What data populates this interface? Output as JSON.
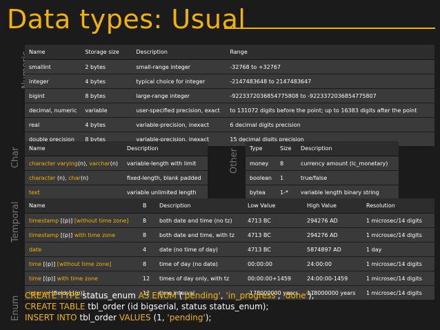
{
  "title": "Data types: Usual",
  "sections": {
    "numeric": "Numeric",
    "char": "Char",
    "other": "Other",
    "temporal": "Temporal",
    "enum": "Enum"
  },
  "numeric_table": {
    "headers": [
      "Name",
      "Storage size",
      "Description",
      "Range"
    ],
    "rows": [
      [
        "smallint",
        "2 bytes",
        "small-range integer",
        "-32768 to +32767"
      ],
      [
        "integer",
        "4 bytes",
        "typical choice for integer",
        "-2147483648 to 2147483647"
      ],
      [
        "bigint",
        "8 bytes",
        "large-range integer",
        "-9223372036854775808 to -9223372036854775807"
      ],
      [
        "decimal, numeric",
        "variable",
        "user-specified precision, exact",
        "to 131072 digits before the point; up to 16383 digits after the point"
      ],
      [
        "real",
        "4 bytes",
        "variable-precision, inexact",
        "6 decimal digits precision"
      ],
      [
        "double precision",
        "8 bytes",
        "variable-precision, inexact",
        "15 decimal digits precision"
      ]
    ]
  },
  "char_table": {
    "headers": [
      "Name",
      "Description"
    ],
    "rows": [
      {
        "n1": "character varying",
        "p1": "(n), ",
        "n2": "varchar",
        "p2": "(n)",
        "desc": "variable-length with limit"
      },
      {
        "n1": "character",
        "p1": " (n), ",
        "n2": "char",
        "p2": "(n)",
        "desc": "fixed-length, blank padded"
      },
      {
        "n1": "text",
        "p1": "",
        "n2": "",
        "p2": "",
        "desc": "variable unlimited length"
      }
    ]
  },
  "other_table": {
    "headers": [
      "Type",
      "Size",
      "Description"
    ],
    "rows": [
      [
        "money",
        "8",
        "currency amount (lc_monetary)"
      ],
      [
        "boolean",
        "1",
        "true/false"
      ],
      [
        "bytea",
        "1-*",
        "variable length binary string"
      ]
    ]
  },
  "temporal_table": {
    "headers": [
      "Name",
      "B",
      "Description",
      "Low Value",
      "High Value",
      "Resolution"
    ],
    "rows": [
      {
        "k1": "timestamp",
        "m": " [(p)] ",
        "k2": "[without time zone]",
        "b": "8",
        "desc": "both date and time (no tz)",
        "low": "4713 BC",
        "high": "294276 AD",
        "res": "1 microsec/14 digits"
      },
      {
        "k1": "timestamp",
        "m": " [(p)] ",
        "k2": "with time zone",
        "b": "8",
        "desc": "both date and time, with tz",
        "low": "4713 BC",
        "high": "294276 AD",
        "res": "1 microsec/14 digits"
      },
      {
        "k1": "date",
        "m": "",
        "k2": "",
        "b": "4",
        "desc": "date (no time of day)",
        "low": "4713 BC",
        "high": "5874897 AD",
        "res": "1 day"
      },
      {
        "k1": "time",
        "m": " [(p)] ",
        "k2": "[without time zone]",
        "b": "8",
        "desc": "time of day (no date)",
        "low": "00:00:00",
        "high": "24:00:00",
        "res": "1 microsec/14 digits"
      },
      {
        "k1": "time",
        "m": " [(p)] ",
        "k2": "with time zone",
        "b": "12",
        "desc": "times of day only, with tz",
        "low": "00:00:00+1459",
        "high": "24:00:00-1459",
        "res": "1 microsec/14 digits"
      },
      {
        "k1": "interval",
        "m": " [fields] [(p)]",
        "k2": "",
        "b": "12",
        "desc": "time interval",
        "low": "-178000000 years",
        "high": "178000000 years",
        "res": "1 microsec/14 digits"
      }
    ]
  },
  "enum_code": {
    "line1": {
      "kw1": "CREATE TYPE",
      "t1": " status_enum ",
      "kw2": "AS ENUM",
      "t2": " (",
      "s1": "'pending'",
      "t3": ", ",
      "s2": "'in_progress'",
      "t4": ", ",
      "s3": "'done'",
      "t5": ");"
    },
    "line2": {
      "kw1": "CREATE TABLE",
      "t1": " tbl_order (id bigserial, status status_enum);"
    },
    "line3": {
      "kw1": "INSERT INTO",
      "t1": " tbl_order ",
      "kw2": "VALUES",
      "t2": " (1, ",
      "s1": "'pending'",
      "t3": ");"
    }
  },
  "colors": {
    "accent": "#f3b400",
    "background": "#1b1b1b",
    "header_bg": "#2d2d2d",
    "row_bg": "#3a3a3a",
    "side_label": "#777777"
  }
}
